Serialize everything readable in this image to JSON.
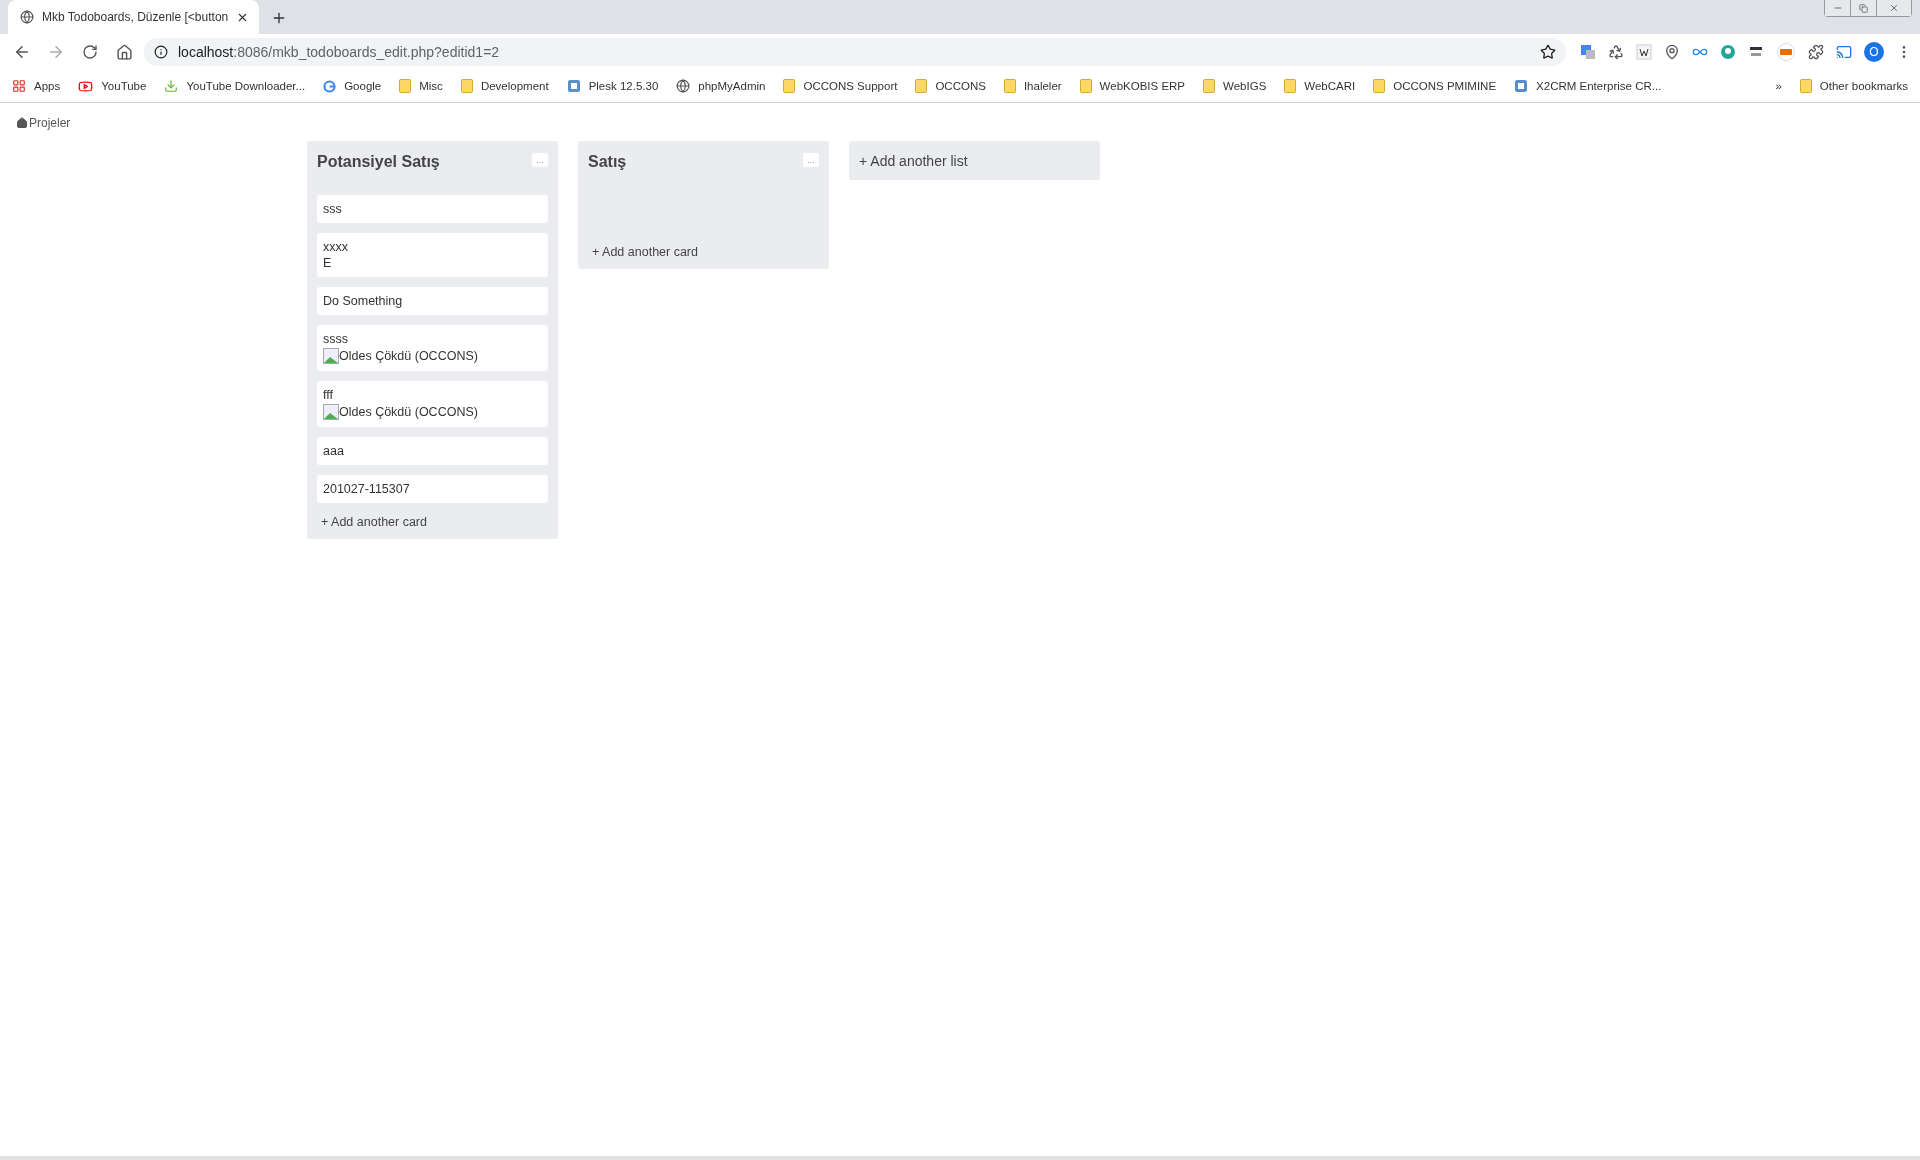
{
  "browser": {
    "tab_title": "Mkb Todoboards, Düzenle [<button",
    "url_host": "localhost",
    "url_rest": ":8086/mkb_todoboards_edit.php?editid1=2",
    "profile_initial": "O",
    "bookmarks": [
      {
        "label": "Apps",
        "kind": "apps"
      },
      {
        "label": "YouTube",
        "kind": "video"
      },
      {
        "label": "YouTube Downloader...",
        "kind": "download"
      },
      {
        "label": "Google",
        "kind": "search"
      },
      {
        "label": "Misc",
        "kind": "folder"
      },
      {
        "label": "Development",
        "kind": "folder"
      },
      {
        "label": "Plesk 12.5.30",
        "kind": "site"
      },
      {
        "label": "phpMyAdmin",
        "kind": "globe"
      },
      {
        "label": "OCCONS Support",
        "kind": "folder"
      },
      {
        "label": "OCCONS",
        "kind": "folder"
      },
      {
        "label": "Ihaleler",
        "kind": "folder"
      },
      {
        "label": "WebKOBIS ERP",
        "kind": "folder"
      },
      {
        "label": "WebIGS",
        "kind": "folder"
      },
      {
        "label": "WebCARI",
        "kind": "folder"
      },
      {
        "label": "OCCONS PMIMINE",
        "kind": "folder"
      },
      {
        "label": "X2CRM Enterprise CR...",
        "kind": "site"
      }
    ],
    "overflow": "»",
    "other_bookmarks": "Other bookmarks"
  },
  "breadcrumb": "Projeler",
  "lists": [
    {
      "title": "Potansiyel Satış",
      "menu": "...",
      "cards": [
        {
          "lines": [
            {
              "kind": "text",
              "text": "sss"
            }
          ]
        },
        {
          "lines": [
            {
              "kind": "text",
              "text": "xxxx"
            },
            {
              "kind": "text",
              "text": "E"
            }
          ]
        },
        {
          "lines": [
            {
              "kind": "text",
              "text": "Do Something"
            }
          ]
        },
        {
          "lines": [
            {
              "kind": "text",
              "text": "ssss"
            },
            {
              "kind": "broken_image",
              "text": "Oldes Çökdü (OCCONS)"
            }
          ]
        },
        {
          "lines": [
            {
              "kind": "text",
              "text": "fff"
            },
            {
              "kind": "broken_image",
              "text": "Oldes Çökdü (OCCONS)"
            }
          ]
        },
        {
          "lines": [
            {
              "kind": "text",
              "text": "aaa"
            }
          ]
        },
        {
          "lines": [
            {
              "kind": "text",
              "text": "201027-115307"
            }
          ]
        }
      ],
      "add_card": "+ Add another card"
    },
    {
      "title": "Satış",
      "menu": "...",
      "add_card": "+ Add another card"
    }
  ],
  "add_list": "+ Add another list"
}
